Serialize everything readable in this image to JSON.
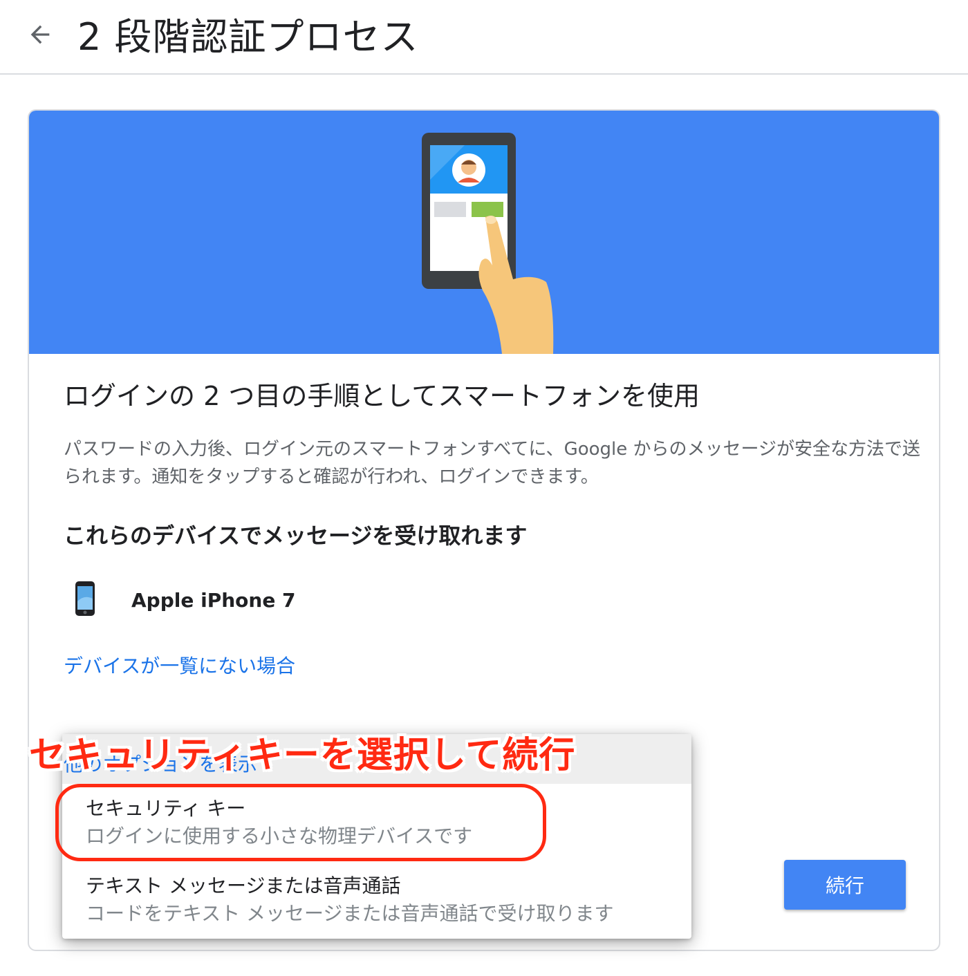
{
  "header": {
    "back_icon": "arrow-back-icon",
    "title": "2 段階認証プロセス"
  },
  "hero": {
    "background_color": "#4285f4",
    "illustration": "phone-tap-illustration"
  },
  "content": {
    "headline": "ログインの 2 つ目の手順としてスマートフォンを使用",
    "description": "パスワードの入力後、ログイン元のスマートフォンすべてに、Google からのメッセージが安全な方法で送られます。通知をタップすると確認が行われ、ログインできます。",
    "devices_heading": "これらのデバイスでメッセージを受け取れます",
    "device": {
      "icon": "smartphone-icon",
      "name": "Apple iPhone 7"
    },
    "missing_device_link": "デバイスが一覧にない場合",
    "other_options_link": "他のオプションを表示"
  },
  "dropdown": {
    "options": [
      {
        "title": "セキュリティ キー",
        "description": "ログインに使用する小さな物理デバイスです"
      },
      {
        "title": "テキスト メッセージまたは音声通話",
        "description": "コードをテキスト メッセージまたは音声通話で受け取ります"
      }
    ]
  },
  "buttons": {
    "continue_label": "続行",
    "accent_color": "#4285f4"
  },
  "annotation": {
    "text": "セキュリティキーを選択して続行",
    "color": "#ff2a12"
  }
}
